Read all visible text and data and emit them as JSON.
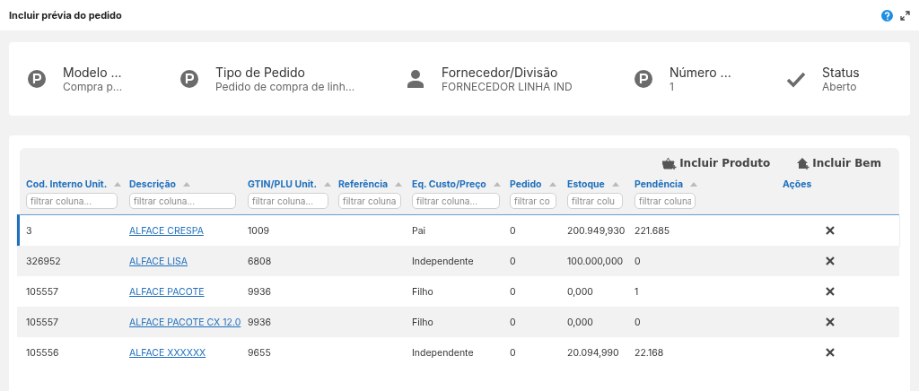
{
  "window": {
    "title": "Incluir prévia do pedido"
  },
  "summary": [
    {
      "kind": "p",
      "label": "Modelo ...",
      "value": "Compra p..."
    },
    {
      "kind": "p",
      "label": "Tipo de Pedido",
      "value": "Pedido de compra de linh..."
    },
    {
      "kind": "person",
      "label": "Fornecedor/Divisão",
      "value": "FORNECEDOR LINHA IND"
    },
    {
      "kind": "p",
      "label": "Número ...",
      "value": "1"
    },
    {
      "kind": "check",
      "label": "Status",
      "value": "Aberto"
    }
  ],
  "actions": [
    {
      "kind": "product",
      "label": "Incluir Produto"
    },
    {
      "kind": "asset",
      "label": "Incluir Bem"
    }
  ],
  "table": {
    "columns": [
      {
        "label": "Cod. Interno Unit.",
        "placeholder": "filtrar coluna..."
      },
      {
        "label": "Descrição",
        "placeholder": "filtrar coluna..."
      },
      {
        "label": "GTIN/PLU Unit.",
        "placeholder": "filtrar coluna..."
      },
      {
        "label": "Referência",
        "placeholder": "filtrar coluna"
      },
      {
        "label": "Eq. Custo/Preço",
        "placeholder": "filtrar coluna..."
      },
      {
        "label": "Pedido",
        "placeholder": "filtrar co"
      },
      {
        "label": "Estoque",
        "placeholder": "filtrar colu"
      },
      {
        "label": "Pendência",
        "placeholder": "filtrar coluna"
      },
      {
        "label": "Ações"
      }
    ],
    "rows": [
      {
        "selected": true,
        "cells": [
          "3",
          "ALFACE CRESPA",
          "1009",
          "",
          "Pai",
          "0",
          "200.949,930",
          "221.685"
        ]
      },
      {
        "selected": false,
        "cells": [
          "326952",
          "ALFACE LISA",
          "6808",
          "",
          "Independente",
          "0",
          "100.000,000",
          "0"
        ]
      },
      {
        "selected": false,
        "cells": [
          "105557",
          "ALFACE PACOTE",
          "9936",
          "",
          "Filho",
          "0",
          "0,000",
          "1"
        ]
      },
      {
        "selected": false,
        "cells": [
          "105557",
          "ALFACE PACOTE CX 12.0",
          "9936",
          "",
          "Filho",
          "0",
          "0,000",
          "0"
        ]
      },
      {
        "selected": false,
        "cells": [
          "105556",
          "ALFACE XXXXXX",
          "9655",
          "",
          "Independente",
          "0",
          "20.094,990",
          "22.168"
        ]
      }
    ]
  }
}
